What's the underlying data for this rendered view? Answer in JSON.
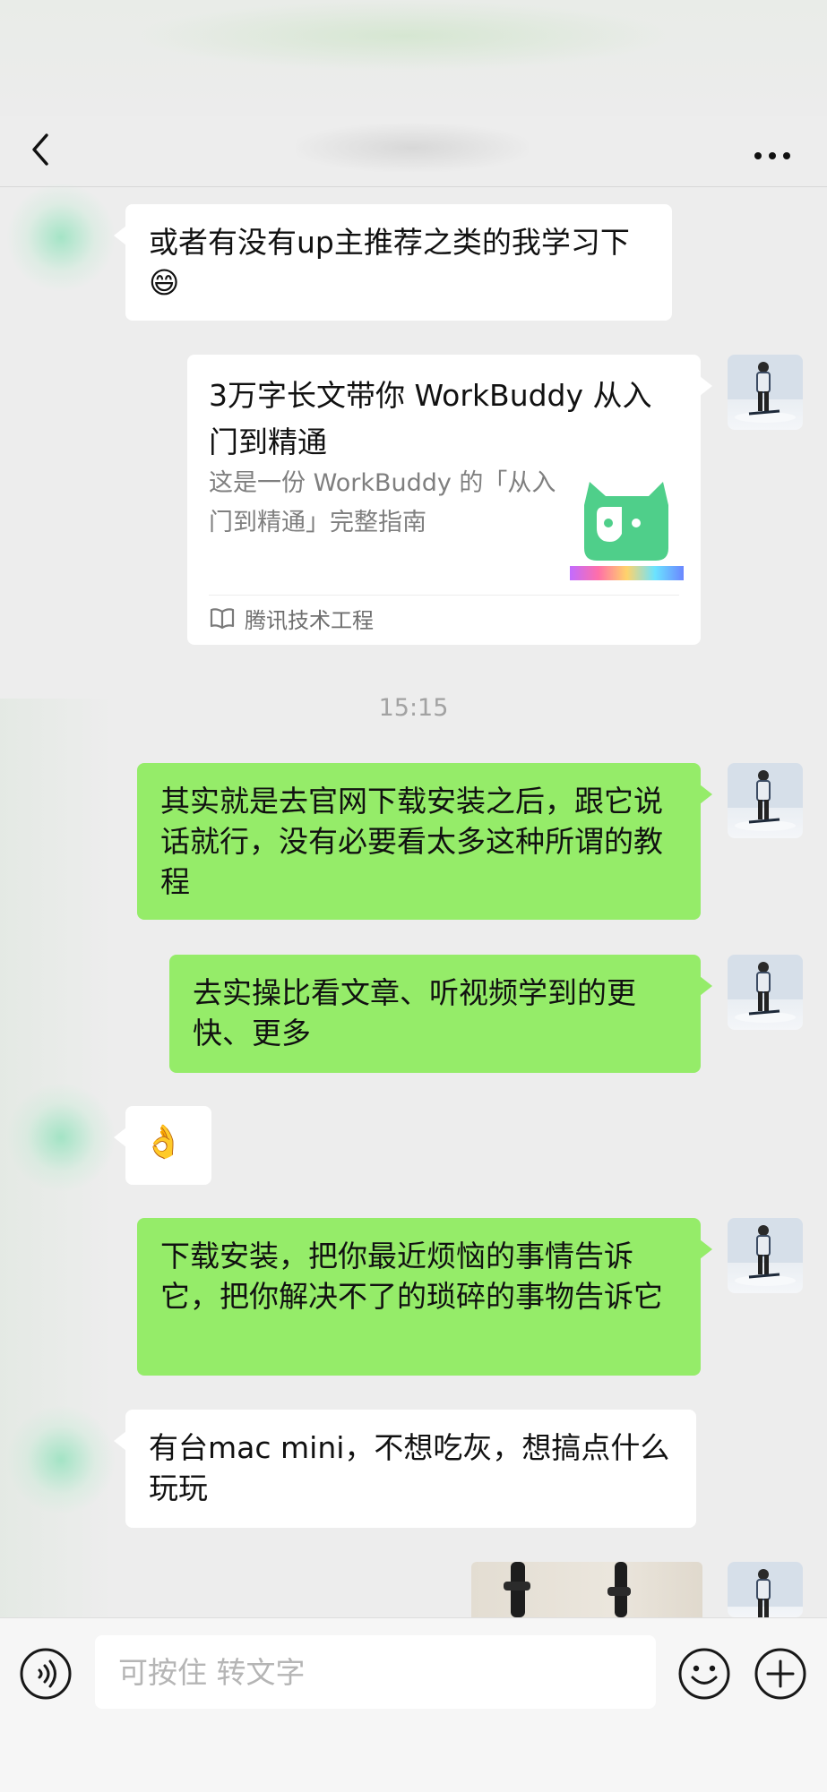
{
  "messages": {
    "m1": "或者有没有up主推荐之类的我学习下😄",
    "timestamp": "15:15",
    "m2": "其实就是去官网下载安装之后，跟它说话就行，没有必要看太多这种所谓的教程",
    "m3": "去实操比看文章、听视频学到的更快、更多",
    "m4": "👌",
    "m5": "下载安装，把你最近烦恼的事情告诉它，把你解决不了的琐碎的事物告诉它",
    "m6": "有台mac mini，不想吃灰，想搞点什么玩玩"
  },
  "article_card": {
    "title": "3万字长文带你 WorkBuddy 从入门到精通",
    "description": "这是一份 WorkBuddy 的「从入门到精通」完整指南",
    "source": "腾讯技术工程",
    "source_icon": "book-icon",
    "thumbnail_icon": "workbuddy-logo",
    "thumbnail_color": "#4fcf8a"
  },
  "input_bar": {
    "placeholder": "可按住 转文字"
  },
  "colors": {
    "background": "#ededed",
    "sent_bubble": "#95ec69",
    "received_bubble": "#ffffff",
    "timestamp": "#a2a2a2"
  }
}
